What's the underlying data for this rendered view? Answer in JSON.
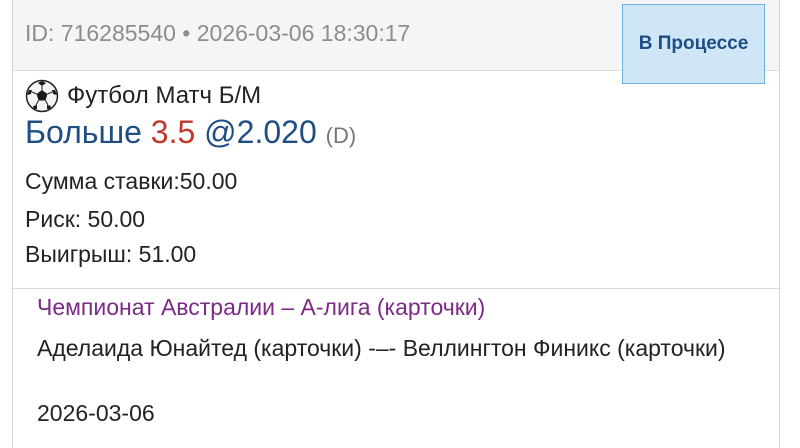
{
  "bet": {
    "id_line": "ID: 716285540 • 2026-03-06 18:30:17",
    "status": "В Процессе",
    "market": "Футбол Матч Б/М",
    "selection": {
      "text": "Больше ",
      "line": "3.5",
      "odds": " @2.020",
      "tag": "(D)"
    },
    "stake": "Сумма ставки:50.00",
    "risk": "Риск: 50.00",
    "win": "Выигрыш: 51.00"
  },
  "event": {
    "league": "Чемпионат Австралии – А-лига (карточки)",
    "teams": "Аделаида Юнайтед (карточки) -–- Веллингтон Финикс (карточки)",
    "date": "2026-03-06"
  },
  "icons": {
    "sport": "soccer-ball-icon"
  },
  "colors": {
    "status_bg": "#cfe6f6",
    "status_border": "#6db3e0",
    "selection_blue": "#1f4e85",
    "line_red": "#c0392b",
    "league_purple": "#7b2a86"
  }
}
